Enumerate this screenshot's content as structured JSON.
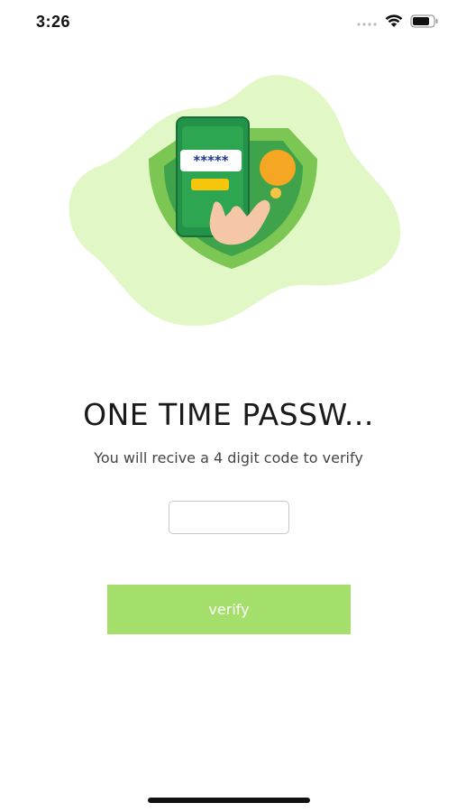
{
  "status_bar": {
    "time": "3:26",
    "icons": [
      "signal-dots-icon",
      "wifi-icon",
      "battery-icon"
    ]
  },
  "illustration": {
    "name": "otp-phone-shield-illustration",
    "password_mask": "*****",
    "colors": {
      "blob": "#e2f7c6",
      "shield_outer": "#7cc653",
      "shield_inner": "#3ea34a",
      "phone_body": "#24934a",
      "coin": "#f5a623",
      "hand": "#f6c7a7"
    }
  },
  "main": {
    "title": "ONE TIME PASSW...",
    "subtitle": "You will recive a 4 digit code to verify",
    "otp_input": {
      "value": "",
      "placeholder": ""
    },
    "verify_label": "verify"
  },
  "colors": {
    "button_bg": "#a5df6b",
    "button_text": "#ffffff",
    "title_text": "#1a1a1a"
  }
}
